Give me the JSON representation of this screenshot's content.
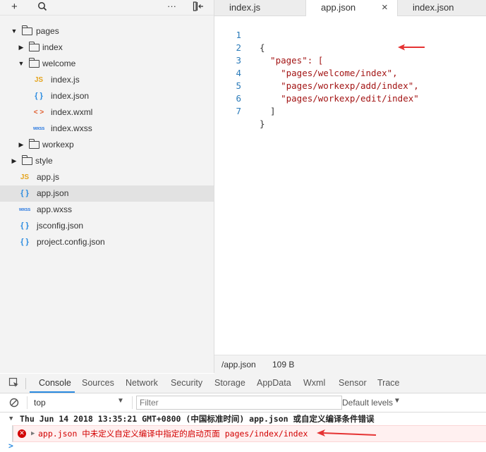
{
  "toolbar": {
    "add_icon": "plus-icon",
    "search_icon": "search-icon",
    "more_icon": "ellipsis-icon",
    "layout_icon": "split-arrow-icon"
  },
  "tree": [
    {
      "label": "pages",
      "type": "folder",
      "expanded": true
    },
    {
      "label": "index",
      "type": "folder",
      "expanded": false
    },
    {
      "label": "welcome",
      "type": "folder",
      "expanded": true
    },
    {
      "label": "index.js",
      "type": "js",
      "badge": "JS"
    },
    {
      "label": "index.json",
      "type": "json",
      "badge": "{ }"
    },
    {
      "label": "index.wxml",
      "type": "wxml",
      "badge": "< >"
    },
    {
      "label": "index.wxss",
      "type": "wxss",
      "badge": "wxss"
    },
    {
      "label": "workexp",
      "type": "folder",
      "expanded": false
    },
    {
      "label": "style",
      "type": "folder",
      "expanded": false
    },
    {
      "label": "app.js",
      "type": "js",
      "badge": "JS"
    },
    {
      "label": "app.json",
      "type": "json",
      "badge": "{ }",
      "selected": true
    },
    {
      "label": "app.wxss",
      "type": "wxss",
      "badge": "wxss"
    },
    {
      "label": "jsconfig.json",
      "type": "json",
      "badge": "{ }"
    },
    {
      "label": "project.config.json",
      "type": "json",
      "badge": "{ }"
    }
  ],
  "tabs": [
    {
      "label": "index.js"
    },
    {
      "label": "app.json",
      "active": true,
      "close": "×"
    },
    {
      "label": "index.json"
    }
  ],
  "editor": {
    "lines": [
      {
        "n": "1",
        "text": "{"
      },
      {
        "n": "2",
        "text": "  \"pages\": ["
      },
      {
        "n": "3",
        "text": "    \"pages/welcome/index\","
      },
      {
        "n": "4",
        "text": "    \"pages/workexp/add/index\","
      },
      {
        "n": "5",
        "text": "    \"pages/workexp/edit/index\""
      },
      {
        "n": "6",
        "text": "  ]"
      },
      {
        "n": "7",
        "text": "}"
      }
    ]
  },
  "status": {
    "path": "/app.json",
    "size": "109 B"
  },
  "devtools": {
    "tabs": [
      "Console",
      "Sources",
      "Network",
      "Security",
      "Storage",
      "AppData",
      "Wxml",
      "Sensor",
      "Trace"
    ],
    "context": "top",
    "filter_placeholder": "Filter",
    "levels": "Default levels",
    "group_header": "Thu Jun 14 2018 13:35:21 GMT+0800 (中国标准时间) app.json 或自定义编译条件错误",
    "error_text": "app.json 中未定义自定义编译中指定的启动页面 pages/index/index",
    "prompt": ">"
  },
  "colors": {
    "error": "#d20000",
    "error_bg": "#fff0f0",
    "accent": "#2a8be0",
    "arrow": "#e53333"
  }
}
